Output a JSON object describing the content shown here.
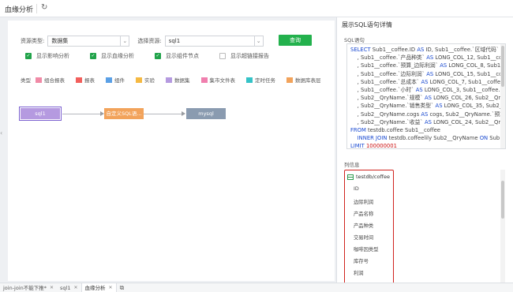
{
  "topbar": {
    "title": "血缘分析",
    "refresh_icon": "refresh-icon"
  },
  "query": {
    "resource_type_label": "资源类型:",
    "resource_type_value": "数据集",
    "select_resource_label": "选择资源:",
    "select_resource_value": "sql1",
    "query_button": "查询"
  },
  "options": [
    {
      "label": "显示影响分析",
      "checked": true
    },
    {
      "label": "显示血缘分析",
      "checked": true
    },
    {
      "label": "显示组件节点",
      "checked": true
    },
    {
      "label": "显示超链接报告",
      "checked": false
    }
  ],
  "legend": {
    "title": "类型",
    "items": [
      {
        "label": "组合报表",
        "color": "#f08aa6"
      },
      {
        "label": "报表",
        "color": "#f25f5c"
      },
      {
        "label": "组件",
        "color": "#5aa0e6"
      },
      {
        "label": "实验",
        "color": "#f5b942"
      },
      {
        "label": "数据集",
        "color": "#b59ae0"
      },
      {
        "label": "集市文件表",
        "color": "#f07fae"
      },
      {
        "label": "定时任务",
        "color": "#35c3c7"
      },
      {
        "label": "数据库表层",
        "color": "#f2a35b"
      }
    ]
  },
  "graph": {
    "nodes": [
      {
        "label": "sql1",
        "color": "#b59ae0"
      },
      {
        "label": "自定义SQL语...",
        "color": "#f2a35b"
      },
      {
        "label": "mysql",
        "color": "#8a9bb0"
      }
    ]
  },
  "panel": {
    "title": "展示SQL语句详情",
    "sql_label": "SQL语句",
    "column_info_label": "列信息",
    "table_name": "testdb/coffee",
    "columns": [
      "ID",
      "边际利润",
      "产品名称",
      "产品种类",
      "交易时间",
      "咖啡因类型",
      "库存号",
      "利润",
      "..."
    ]
  },
  "bottom_tabs": [
    {
      "label": "join-join不能下推*",
      "active": false
    },
    {
      "label": "sql1",
      "active": false
    },
    {
      "label": "血缘分析",
      "active": true
    }
  ]
}
